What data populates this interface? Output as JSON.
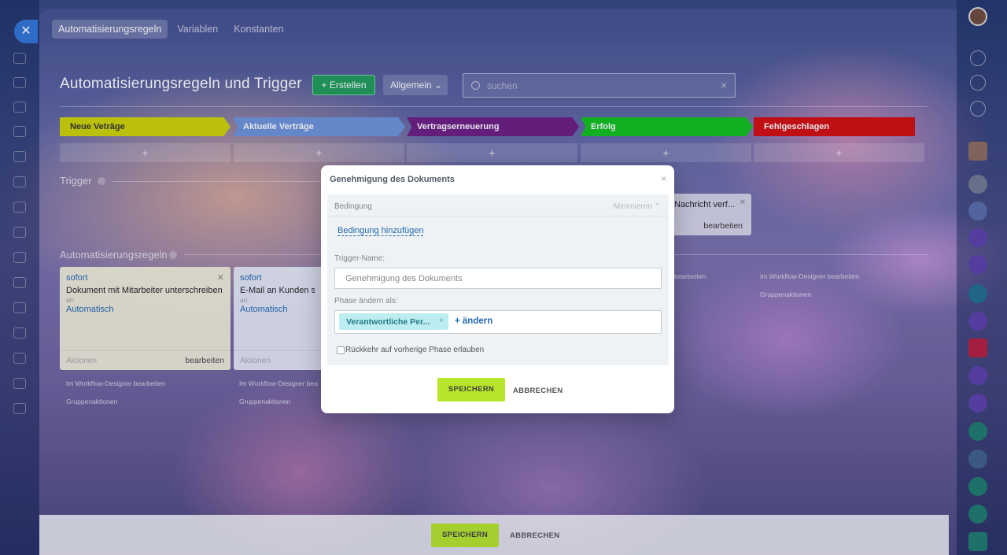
{
  "tabs": [
    "Automatisierungsregeln",
    "Variablen",
    "Konstanten"
  ],
  "header": {
    "title": "Automatisierungsregeln und Trigger",
    "create_label": "+ Erstellen",
    "general_label": "Allgemein",
    "search_placeholder": "suchen"
  },
  "stages": [
    {
      "label": "Neue Veträge",
      "color": "#cfd400"
    },
    {
      "label": "Aktuelle Verträge",
      "color": "#6d93d9"
    },
    {
      "label": "Vertragserneuerung",
      "color": "#6b1b7f"
    },
    {
      "label": "Erfolg",
      "color": "#0fc21a"
    },
    {
      "label": "Fehlgeschlagen",
      "color": "#d40b0b"
    }
  ],
  "plus_symbol": "+",
  "trigger_section": "Trigger",
  "trigger_card": {
    "title": "Nachricht verf...",
    "edit": "bearbeiten"
  },
  "rules_section": "Automatisierungsregeln",
  "rule_cards": [
    {
      "when": "sofort",
      "name": "Dokument mit Mitarbeiter unterschreiben",
      "to": "an:",
      "who": "Automatisch",
      "actions": "Aktionen",
      "edit": "bearbeiten"
    },
    {
      "when": "sofort",
      "name": "E-Mail an Kunden sen",
      "to": "an:",
      "who": "Automatisch",
      "actions": "Aktionen",
      "edit": ""
    }
  ],
  "links": {
    "designer": "Im Workflow-Designer bearbeiten",
    "designer_short": "Im Workflow-Designer bea",
    "group": "Gruppenaktionen",
    "designer_right": "Im Workflow-Designer bearbeiten",
    "group_right": "Gruppenaktionen",
    "edit_right": "bearbeiten"
  },
  "footer": {
    "save": "SPEICHERN",
    "cancel": "ABBRECHEN"
  },
  "modal": {
    "title": "Genehmigung des Dokuments",
    "condition_label": "Bedingung",
    "minimize": "Minimieren",
    "add_condition": "Bedingung hinzufügen",
    "trigger_name_label": "Trigger-Name:",
    "trigger_name_value": "Genehmigung des Dokuments",
    "phase_label": "Phase ändern als:",
    "chip": "Verantwortliche Per...",
    "change": "+ ändern",
    "return_label": "Rückkehr auf vorherige Phase erlauben",
    "save": "SPEICHERN",
    "cancel": "ABBRECHEN"
  }
}
